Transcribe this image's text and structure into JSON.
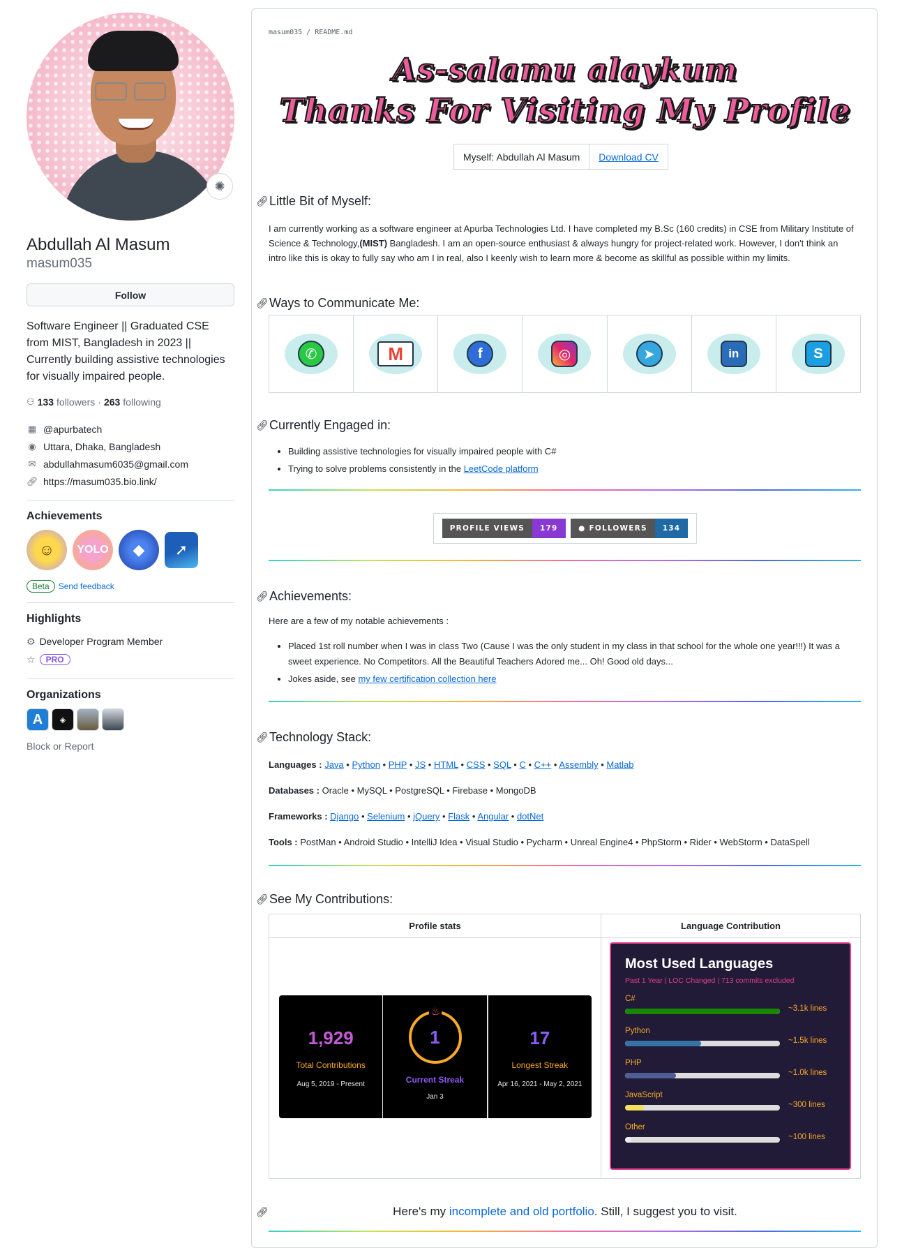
{
  "profile": {
    "fullname": "Abdullah Al Masum",
    "username": "masum035",
    "follow_label": "Follow",
    "bio": "Software Engineer || Graduated CSE from MIST, Bangladesh in 2023 || Currently building assistive technologies for visually impaired people.",
    "followers_count": "133",
    "followers_label": "followers",
    "following_count": "263",
    "following_label": "following",
    "separator": "·",
    "company": "@apurbatech",
    "location": "Uttara, Dhaka, Bangladesh",
    "email": "abdullahmasum6035@gmail.com",
    "website": "https://masum035.bio.link/"
  },
  "sidebar": {
    "achievements_title": "Achievements",
    "beta_label": "Beta",
    "feedback_label": "Send feedback",
    "highlights_title": "Highlights",
    "developer_program": "Developer Program Member",
    "pro_label": "PRO",
    "organizations_title": "Organizations",
    "block_label": "Block or Report"
  },
  "readme": {
    "path": "masum035 / README.md",
    "hero_line1": "As-salamu alaykum",
    "hero_line2": "Thanks For Visiting My Profile",
    "myself_label": "Myself: Abdullah Al Masum",
    "download_cv": "Download CV",
    "h_little_bit": "Little Bit of Myself:",
    "about_1": "I am currently working as a software engineer at Apurba Technologies Ltd. I have completed my B.Sc (160 credits) in CSE from Military Institute of Science & Technology,",
    "about_mist": "(MIST)",
    "about_2": " Bangladesh. I am an open-source enthusiast & always hungry for project-related work. However, I don't think an intro like this is okay to fully say who am I in real, also I keenly wish to learn more & become as skillful as possible within my limits.",
    "h_communicate": "Ways to Communicate Me:",
    "h_engaged": "Currently Engaged in:",
    "engaged_1": "Building assistive technologies for visually impaired people with C#",
    "engaged_2_prefix": "Trying to solve problems consistently in the ",
    "engaged_2_link": "LeetCode platform",
    "profile_views_label": "PROFILE VIEWS",
    "profile_views_value": "179",
    "followers_badge_label": "FOLLOWERS",
    "followers_badge_value": "134",
    "h_achievements": "Achievements:",
    "achievements_intro": "Here are a few of my notable achievements :",
    "achievement_1": "Placed 1st roll number when I was in class Two (Cause I was the only student in my class in that school for the whole one year!!!) It was a sweet experience. No Competitors. All the Beautiful Teachers Adored me... Oh! Good old days...",
    "achievement_2_prefix": "Jokes aside, see ",
    "achievement_2_link": "my few certification collection here",
    "h_tech": "Technology Stack:",
    "languages_label": "Languages :",
    "languages": [
      "Java",
      "Python",
      "PHP",
      "JS",
      "HTML",
      "CSS",
      "SQL",
      "C",
      "C++",
      "Assembly",
      "Matlab"
    ],
    "databases_label": "Databases :",
    "databases": "Oracle • MySQL • PostgreSQL • Firebase • MongoDB",
    "frameworks_label": "Frameworks :",
    "frameworks": [
      "Django",
      "Selenium",
      "jQuery",
      "Flask",
      "Angular",
      "dotNet"
    ],
    "tools_label": "Tools :",
    "tools": "PostMan • Android Studio • IntelliJ Idea • Visual Studio • Pycharm • Unreal Engine4 • PhpStorm • Rider • WebStorm • DataSpell",
    "h_contrib": "See My Contributions:",
    "col_profile_stats": "Profile stats",
    "col_lang_contrib": "Language Contribution",
    "portfolio_prefix": "Here's my ",
    "portfolio_link": "incomplete and old portfolio",
    "portfolio_suffix": ". Still, I suggest you to visit."
  },
  "streak": {
    "total": "1,929",
    "total_label": "Total Contributions",
    "total_range": "Aug 5, 2019 - Present",
    "current": "1",
    "current_label": "Current Streak",
    "current_range": "Jan 3",
    "longest": "17",
    "longest_label": "Longest Streak",
    "longest_range": "Apr 16, 2021 - May 2, 2021"
  },
  "languages_card": {
    "title": "Most Used Languages",
    "subtitle": "Past 1 Year | LOC Changed | 713 commits excluded",
    "items": [
      {
        "name": "C#",
        "lines": "~3.1k lines",
        "fraction": 1.0,
        "color": "#178600"
      },
      {
        "name": "Python",
        "lines": "~1.5k lines",
        "fraction": 0.49,
        "color": "#3572a5"
      },
      {
        "name": "PHP",
        "lines": "~1.0k lines",
        "fraction": 0.33,
        "color": "#4f5d95"
      },
      {
        "name": "JavaScript",
        "lines": "~300 lines",
        "fraction": 0.12,
        "color": "#f1e05a"
      },
      {
        "name": "Other",
        "lines": "~100 lines",
        "fraction": 0.04,
        "color": "#ededed"
      }
    ]
  },
  "colors": {
    "link": "#0969da",
    "views_accent": "#8a38d4",
    "followers_accent": "#1f6aa5",
    "hero_pink": "#eb5d9b"
  },
  "icons": {
    "status": "orbit-icon",
    "followers": "people-icon",
    "company": "building-icon",
    "location": "location-icon",
    "email": "mail-icon",
    "website": "link-icon"
  }
}
